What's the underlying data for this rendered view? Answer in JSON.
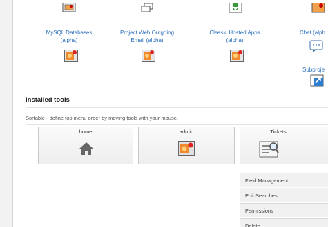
{
  "top_tools": [
    {
      "label_line1": "MySQL Databases",
      "label_line2": "(alpha)",
      "icon": "bug-gear-icon"
    },
    {
      "label_line1": "Project Web Outgoing",
      "label_line2": "Email (alpha)",
      "icon": "bug-gear-icon"
    },
    {
      "label_line1": "Classic Hosted Apps",
      "label_line2": "(alpha)",
      "icon": "bug-gear-icon"
    },
    {
      "label_line1": "Chat (alph",
      "label_line2": "",
      "icon": "chat-bubble-icon"
    },
    {
      "label_line1": "Subproje",
      "label_line2": "",
      "icon": "subproject-icon"
    }
  ],
  "installed": {
    "title": "Installed tools",
    "hint": "Sortable - define top menu order by moving tools with your mouse."
  },
  "cards": [
    {
      "label": "home",
      "icon": "home-icon"
    },
    {
      "label": "admin",
      "icon": "admin-gear-icon"
    },
    {
      "label": "Tickets",
      "icon": "tickets-icon"
    }
  ],
  "ticket_menu": [
    "Field Management",
    "Edit Searches",
    "Permissions",
    "Delete"
  ]
}
